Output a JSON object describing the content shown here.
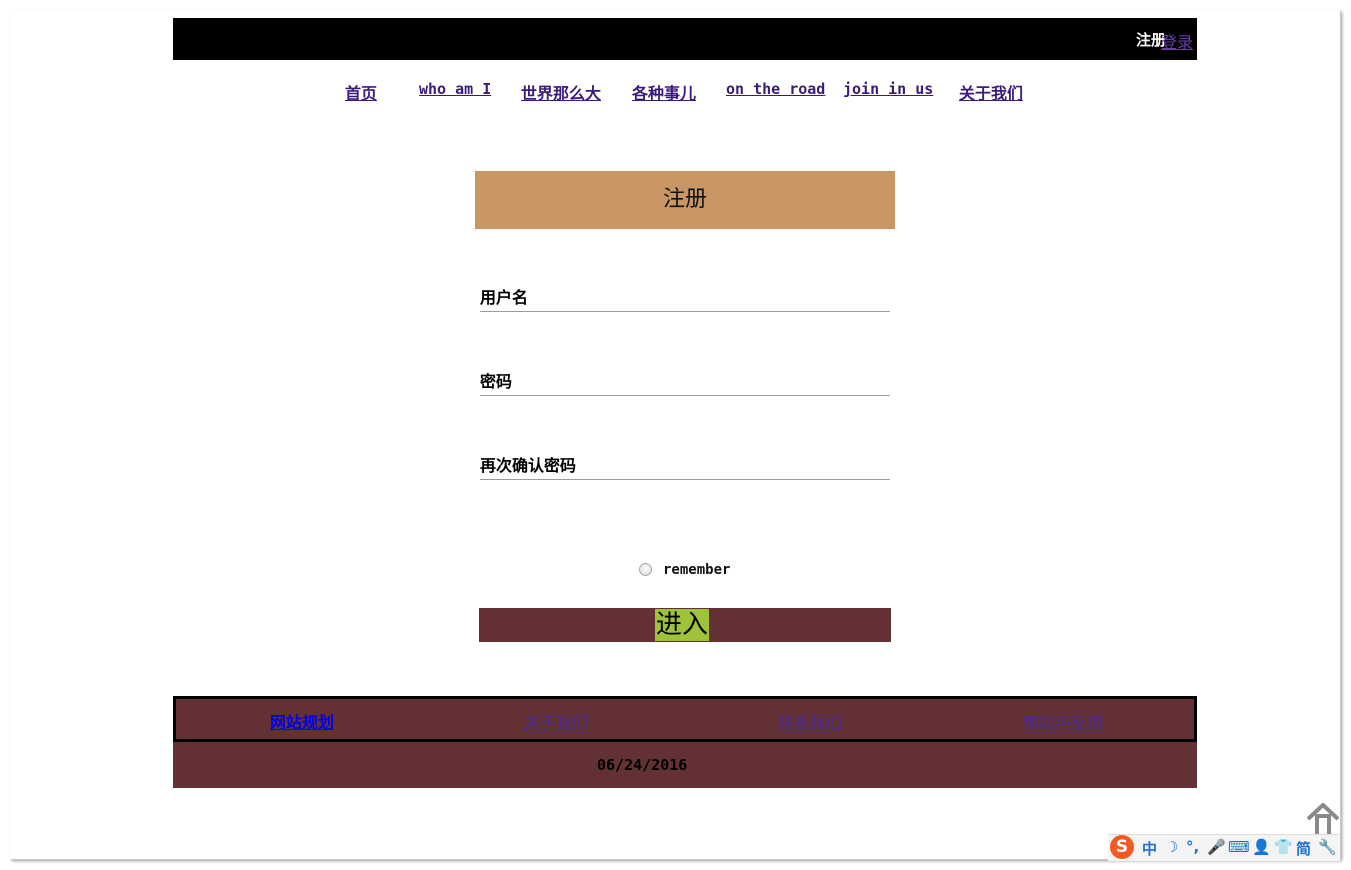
{
  "header": {
    "register": "注册",
    "login": "登录"
  },
  "nav": [
    {
      "label": "首页"
    },
    {
      "label": "who am I"
    },
    {
      "label": "世界那么大"
    },
    {
      "label": "各种事儿"
    },
    {
      "label": "on the road"
    },
    {
      "label": "join in us"
    },
    {
      "label": "关于我们"
    }
  ],
  "form": {
    "title": "注册",
    "username_label": "用户名",
    "password_label": "密码",
    "confirm_label": "再次确认密码",
    "remember_label": "remember",
    "submit_label": "进入"
  },
  "footer": {
    "links": [
      {
        "label": "网站规划",
        "color": "#0000ee"
      },
      {
        "label": "关于我们",
        "color": "#4a2a9a"
      },
      {
        "label": "联系我们",
        "color": "#4a2a9a"
      },
      {
        "label": "帮助与反馈",
        "color": "#4a2a9a"
      }
    ],
    "date": "06/24/2016"
  },
  "ime": {
    "logo": "S",
    "glyphs": [
      {
        "name": "chinese-mode-icon",
        "text": "中"
      },
      {
        "name": "moon-icon",
        "text": "☽"
      },
      {
        "name": "punctuation-icon",
        "text": "°,"
      },
      {
        "name": "microphone-icon",
        "text": "🎤"
      },
      {
        "name": "keyboard-icon",
        "text": "⌨"
      },
      {
        "name": "user-icon",
        "text": "👤"
      },
      {
        "name": "shirt-icon",
        "text": "👕"
      },
      {
        "name": "simplified-icon",
        "text": "简"
      },
      {
        "name": "wrench-icon",
        "text": "🔧"
      }
    ]
  },
  "colors": {
    "topbar": "#000000",
    "form_title_bg": "#c89665",
    "maroon": "#633134",
    "submit_bg": "#9ec33b"
  }
}
